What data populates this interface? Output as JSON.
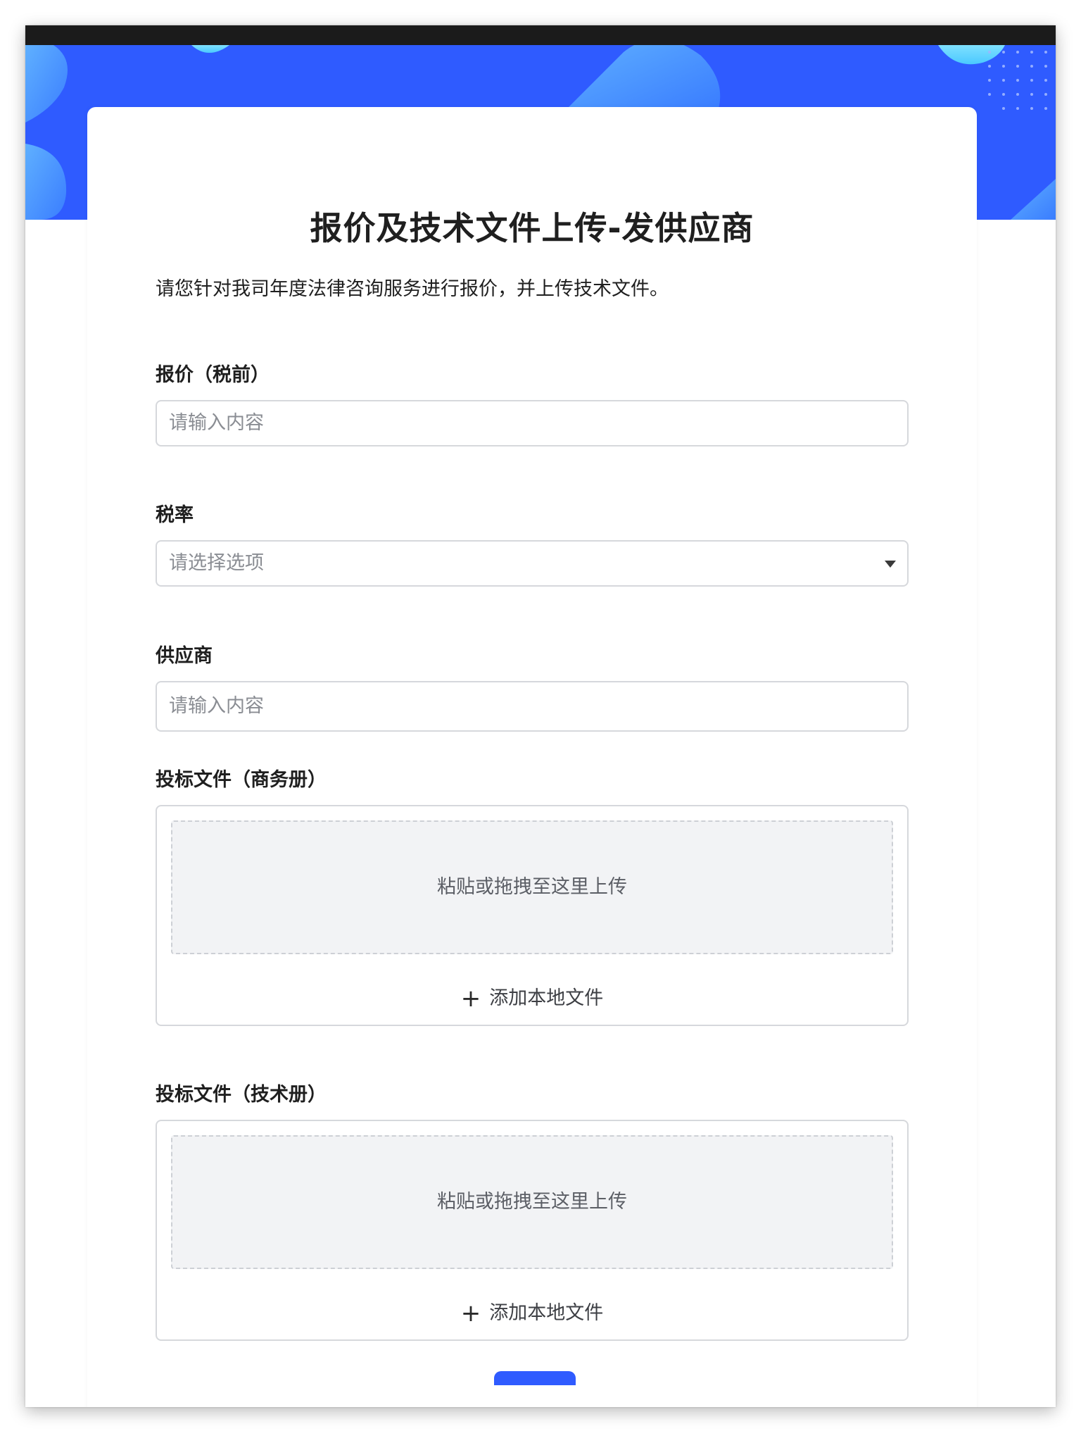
{
  "form": {
    "title": "报价及技术文件上传-发供应商",
    "description": "请您针对我司年度法律咨询服务进行报价，并上传技术文件。"
  },
  "fields": {
    "price": {
      "label": "报价（税前）",
      "placeholder": "请输入内容"
    },
    "tax_rate": {
      "label": "税率",
      "placeholder": "请选择选项"
    },
    "supplier": {
      "label": "供应商",
      "placeholder": "请输入内容"
    },
    "business_file": {
      "label": "投标文件（商务册）",
      "dropzone_text": "粘贴或拖拽至这里上传",
      "add_label": "添加本地文件"
    },
    "technical_file": {
      "label": "投标文件（技术册）",
      "dropzone_text": "粘贴或拖拽至这里上传",
      "add_label": "添加本地文件"
    }
  },
  "icons": {
    "select_arrow": "caret-down-icon",
    "add_file": "plus-icon"
  },
  "colors": {
    "banner": "#2f5bff",
    "accent": "#2f5bff",
    "dropzone_bg": "#f2f3f5"
  }
}
